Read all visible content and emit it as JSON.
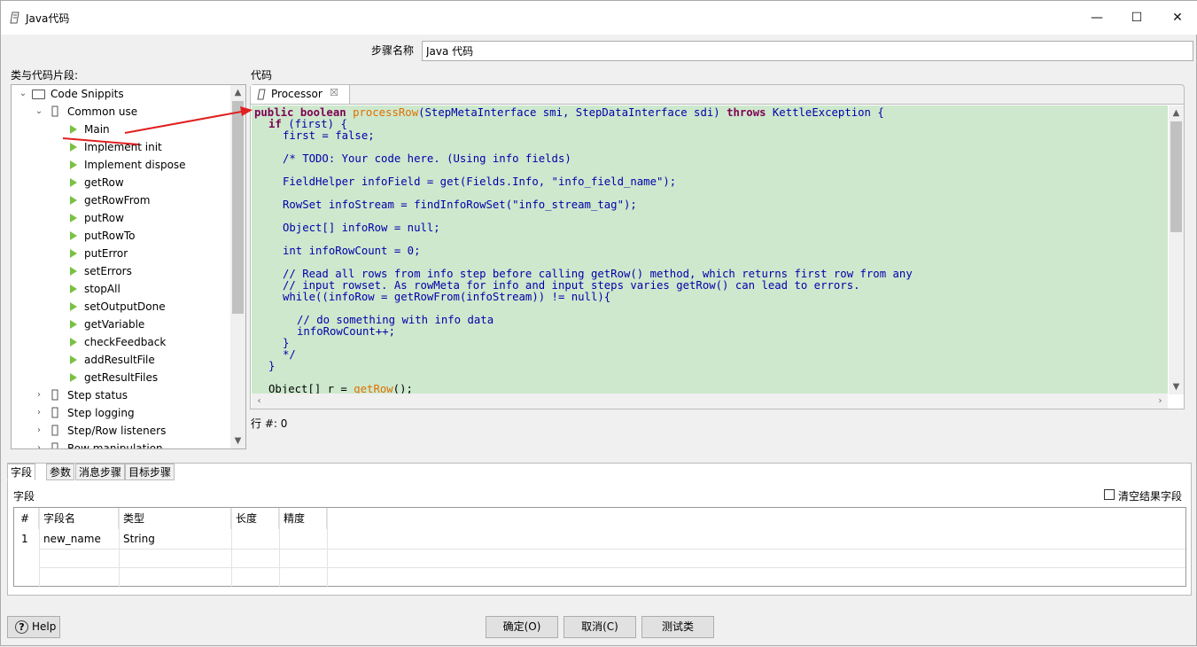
{
  "window": {
    "title": "Java代码",
    "minimize": "—",
    "maximize": "☐",
    "close": "✕"
  },
  "step": {
    "label": "步骤名称",
    "value": "Java 代码"
  },
  "labels": {
    "snippets": "类与代码片段:",
    "code": "代码",
    "row_num": "行 #: 0"
  },
  "tree": {
    "root": "Code Snippits",
    "common_use": "Common use",
    "items": [
      "Main",
      "Implement init",
      "Implement dispose",
      "getRow",
      "getRowFrom",
      "putRow",
      "putRowTo",
      "putError",
      "setErrors",
      "stopAll",
      "setOutputDone",
      "getVariable",
      "checkFeedback",
      "addResultFile",
      "getResultFiles"
    ],
    "groups": [
      "Step status",
      "Step logging",
      "Step/Row listeners",
      "Row manipulation"
    ]
  },
  "editor": {
    "tab": "Processor",
    "lines": {
      "l1_kw": "public boolean ",
      "l1_fn": "processRow",
      "l1_a": "(StepMetaInterface smi, StepDataInterface sdi) ",
      "l1_kw2": "throws",
      "l1_b": " KettleException {",
      "l2_kw": "if",
      "l2_a": " (first) {",
      "l3": "first = false;",
      "l4": "/* TODO: Your code here. (Using info fields)",
      "l5": "FieldHelper infoField = get(Fields.Info, \"info_field_name\");",
      "l6": "RowSet infoStream = findInfoRowSet(\"info_stream_tag\");",
      "l7": "Object[] infoRow = null;",
      "l8": "int infoRowCount = 0;",
      "l9": "// Read all rows from info step before calling getRow() method, which returns first row from any",
      "l10": "// input rowset. As rowMeta for info and input steps varies getRow() can lead to errors.",
      "l11": "while((infoRow = getRowFrom(infoStream)) != null){",
      "l12": "// do something with info data",
      "l13": "infoRowCount++;",
      "l14": "}",
      "l15": "*/",
      "l16": "}",
      "l17_a": "Object[] r = ",
      "l17_fn": "getRow",
      "l17_b": "();"
    }
  },
  "bottom": {
    "tabs": [
      "字段",
      "参数",
      "消息步骤",
      "目标步骤"
    ],
    "section": "字段",
    "clear_label": "清空结果字段",
    "columns": [
      "#",
      "字段名",
      "类型",
      "长度",
      "精度"
    ],
    "rows": [
      {
        "num": "1",
        "name": "new_name",
        "type": "String",
        "length": "",
        "precision": ""
      }
    ]
  },
  "buttons": {
    "help": "Help",
    "ok": "确定(O)",
    "cancel": "取消(C)",
    "test": "测试类"
  },
  "colors": {
    "code_bg": "#cde8cd",
    "keyword": "#7f0055",
    "method": "#e07000",
    "annotation": "#e02020",
    "snippet_icon": "#7ac143"
  }
}
